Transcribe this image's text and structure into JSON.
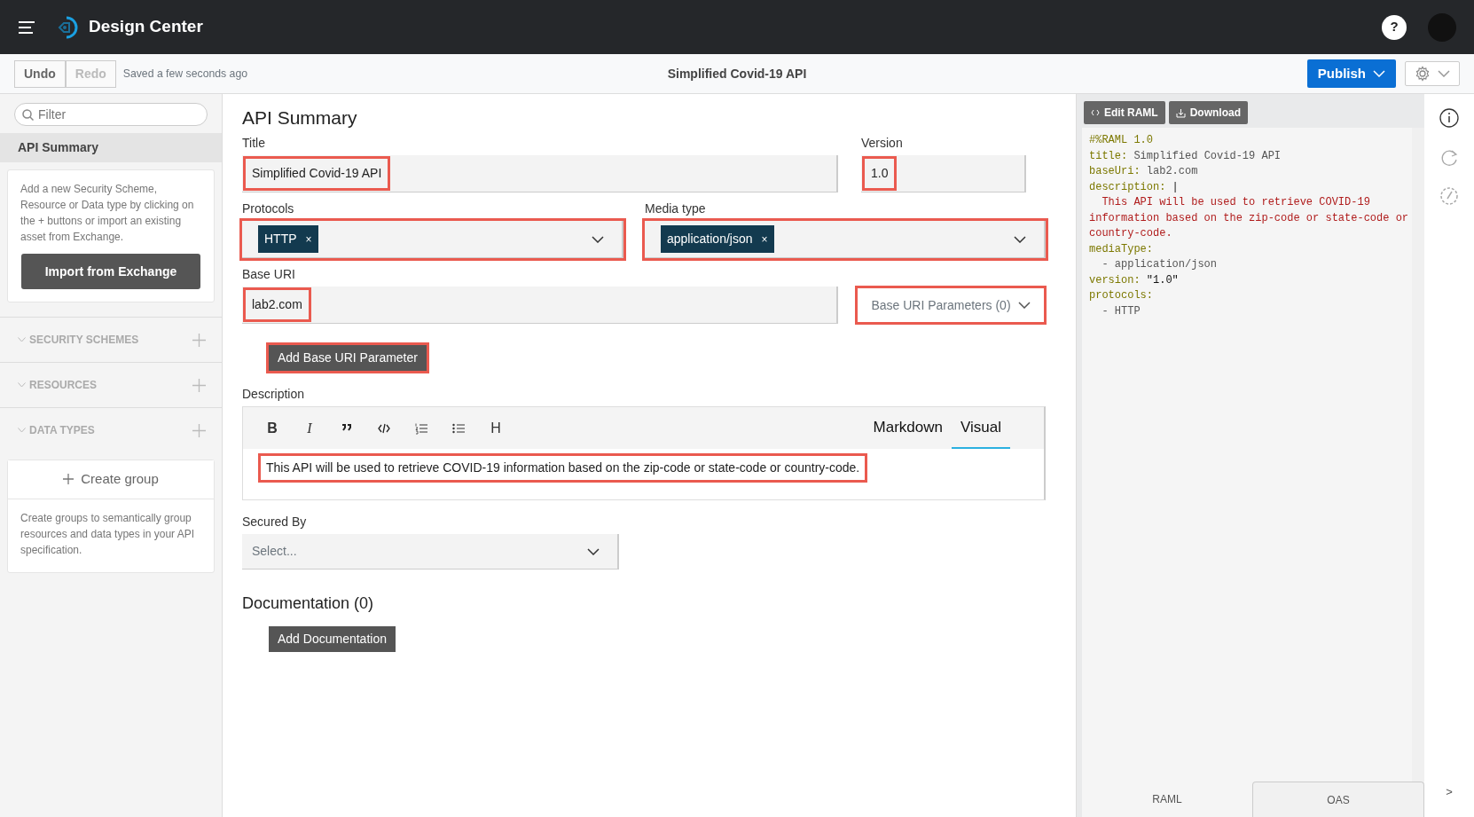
{
  "app": {
    "title": "Design Center"
  },
  "help": {
    "label": "?"
  },
  "toolbar": {
    "undo": {
      "label": "Undo",
      "disabled": false
    },
    "redo": {
      "label": "Redo",
      "disabled": true
    },
    "save_status": "Saved a few seconds ago",
    "project_title": "Simplified Covid-19 API",
    "publish": "Publish"
  },
  "sidebar": {
    "filter_placeholder": "Filter",
    "items": [
      {
        "label": "API Summary",
        "selected": true
      }
    ],
    "info": "Add a new Security Scheme, Resource or Data type by clicking on the + buttons or import an existing asset from Exchange.",
    "import_button": "Import from Exchange",
    "sections": [
      {
        "label": "SECURITY SCHEMES"
      },
      {
        "label": "RESOURCES"
      },
      {
        "label": "DATA TYPES"
      }
    ],
    "create_group": "Create group",
    "create_group_info": "Create groups to semantically group resources and data types in your API specification."
  },
  "summary": {
    "heading": "API Summary",
    "title": {
      "label": "Title",
      "value": "Simplified Covid-19 API",
      "highlighted": true
    },
    "version": {
      "label": "Version",
      "value": "1.0",
      "highlighted": true
    },
    "protocols": {
      "label": "Protocols",
      "tags": [
        {
          "label": "HTTP",
          "remove": "×"
        }
      ],
      "highlighted": true
    },
    "media_type": {
      "label": "Media type",
      "tags": [
        {
          "label": "application/json",
          "remove": "×"
        }
      ],
      "highlighted": true
    },
    "base_uri": {
      "label": "Base URI",
      "value": "lab2.com",
      "highlighted": true
    },
    "base_uri_parameters": {
      "label": "Base URI Parameters (0)",
      "highlighted": true
    },
    "add_parameter": {
      "label": "Add Base URI Parameter",
      "highlighted": true
    },
    "description": {
      "label": "Description",
      "format_buttons": [
        {
          "kind": "bold",
          "label": "B"
        },
        {
          "kind": "italic",
          "label": "I"
        },
        {
          "kind": "quote"
        },
        {
          "kind": "code"
        },
        {
          "kind": "ordered-list"
        },
        {
          "kind": "bullet-list"
        },
        {
          "kind": "heading",
          "label": "H"
        }
      ],
      "modes": [
        {
          "label": "Markdown",
          "selected": false
        },
        {
          "label": "Visual",
          "selected": true
        }
      ],
      "text": "This API will be used to retrieve COVID-19 information based on the zip-code or state-code or country-code.",
      "highlighted": true
    },
    "secured_by": {
      "label": "Secured By",
      "placeholder": "Select..."
    },
    "documentation": {
      "heading": "Documentation (0)",
      "button": "Add Documentation"
    }
  },
  "code_panel": {
    "buttons": [
      {
        "kind": "edit",
        "label": "Edit RAML"
      },
      {
        "kind": "download",
        "label": "Download"
      }
    ],
    "lines": [
      [
        {
          "kind": "meta",
          "text": "#%RAML 1.0"
        }
      ],
      [
        {
          "kind": "key",
          "text": "title:"
        },
        {
          "kind": "value",
          "text": " Simplified Covid-19 API"
        }
      ],
      [
        {
          "kind": "key",
          "text": "baseUri:"
        },
        {
          "kind": "value",
          "text": " lab2.com"
        }
      ],
      [
        {
          "kind": "key",
          "text": "description:"
        },
        {
          "kind": "string",
          "text": " |"
        }
      ],
      [
        {
          "kind": "block",
          "text": "  This API will be used to retrieve COVID-19"
        }
      ],
      [
        {
          "kind": "block",
          "text": "information based on the zip-code or state-code or"
        }
      ],
      [
        {
          "kind": "block",
          "text": "country-code."
        }
      ],
      [
        {
          "kind": "key",
          "text": "mediaType:"
        }
      ],
      [
        {
          "kind": "value",
          "text": "  - application/json"
        }
      ],
      [
        {
          "kind": "key",
          "text": "version:"
        },
        {
          "kind": "string",
          "text": " \"1.0\""
        }
      ],
      [
        {
          "kind": "key",
          "text": "protocols:"
        }
      ],
      [
        {
          "kind": "value",
          "text": "  - HTTP"
        }
      ]
    ],
    "tabs": [
      {
        "label": "RAML",
        "selected": true
      },
      {
        "label": "OAS",
        "selected": false
      }
    ]
  },
  "rail": {
    "expand": ">"
  }
}
